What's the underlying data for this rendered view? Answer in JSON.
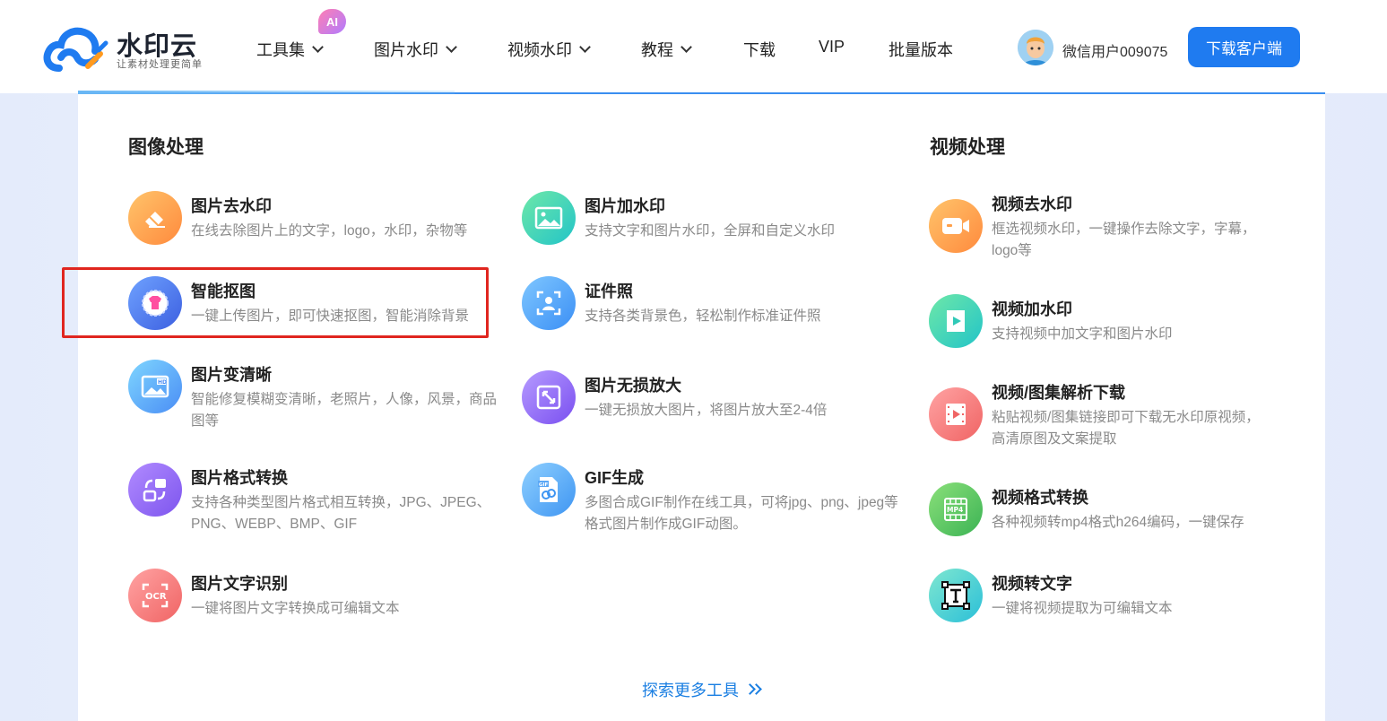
{
  "brand": {
    "name": "水印云",
    "slogan": "让素材处理更简单"
  },
  "nav": {
    "ai_badge": "AI",
    "items": [
      {
        "label": "工具集",
        "dropdown": true
      },
      {
        "label": "图片水印",
        "dropdown": true
      },
      {
        "label": "视频水印",
        "dropdown": true
      },
      {
        "label": "教程",
        "dropdown": true
      },
      {
        "label": "下载",
        "dropdown": false
      },
      {
        "label": "VIP",
        "dropdown": false
      },
      {
        "label": "批量版本",
        "dropdown": false
      }
    ]
  },
  "user": {
    "name": "微信用户009075"
  },
  "download_button": "下载客户端",
  "image_section": {
    "title": "图像处理",
    "tools": [
      {
        "title": "图片去水印",
        "desc": "在线去除图片上的文字，logo，水印，杂物等",
        "icon": "eraser-icon"
      },
      {
        "title": "图片加水印",
        "desc": "支持文字和图片水印，全屏和自定义水印",
        "icon": "image-icon"
      },
      {
        "title": "智能抠图",
        "desc": "一键上传图片，即可快速抠图，智能消除背景",
        "icon": "cutout-icon"
      },
      {
        "title": "证件照",
        "desc": "支持各类背景色，轻松制作标准证件照",
        "icon": "id-photo-icon"
      },
      {
        "title": "图片变清晰",
        "desc": "智能修复模糊变清晰，老照片，人像，风景，商品图等",
        "icon": "hd-image-icon"
      },
      {
        "title": "图片无损放大",
        "desc": "一键无损放大图片，将图片放大至2-4倍",
        "icon": "enlarge-icon"
      },
      {
        "title": "图片格式转换",
        "desc": "支持各种类型图片格式相互转换，JPG、JPEG、PNG、WEBP、BMP、GIF",
        "icon": "convert-icon"
      },
      {
        "title": "GIF生成",
        "desc": "多图合成GIF制作在线工具，可将jpg、png、jpeg等格式图片制作成GIF动图。",
        "icon": "gif-file-icon"
      },
      {
        "title": "图片文字识别",
        "desc": "一键将图片文字转换成可编辑文本",
        "icon": "ocr-icon"
      }
    ]
  },
  "video_section": {
    "title": "视频处理",
    "tools": [
      {
        "title": "视频去水印",
        "desc": "框选视频水印，一键操作去除文字，字幕，logo等",
        "icon": "video-camera-icon"
      },
      {
        "title": "视频加水印",
        "desc": "支持视频中加文字和图片水印",
        "icon": "video-play-icon"
      },
      {
        "title": "视频/图集解析下载",
        "desc": "粘贴视频/图集链接即可下载无水印原视频，高清原图及文案提取",
        "icon": "film-icon"
      },
      {
        "title": "视频格式转换",
        "desc": "各种视频转mp4格式h264编码，一键保存",
        "icon": "mp4-icon"
      },
      {
        "title": "视频转文字",
        "desc": "一键将视频提取为可编辑文本",
        "icon": "text-frame-icon"
      }
    ]
  },
  "more_tools": "探索更多工具",
  "colors": {
    "accent": "#1f7bf0",
    "highlight_border": "#e0261f",
    "link": "#1b7fe2"
  }
}
